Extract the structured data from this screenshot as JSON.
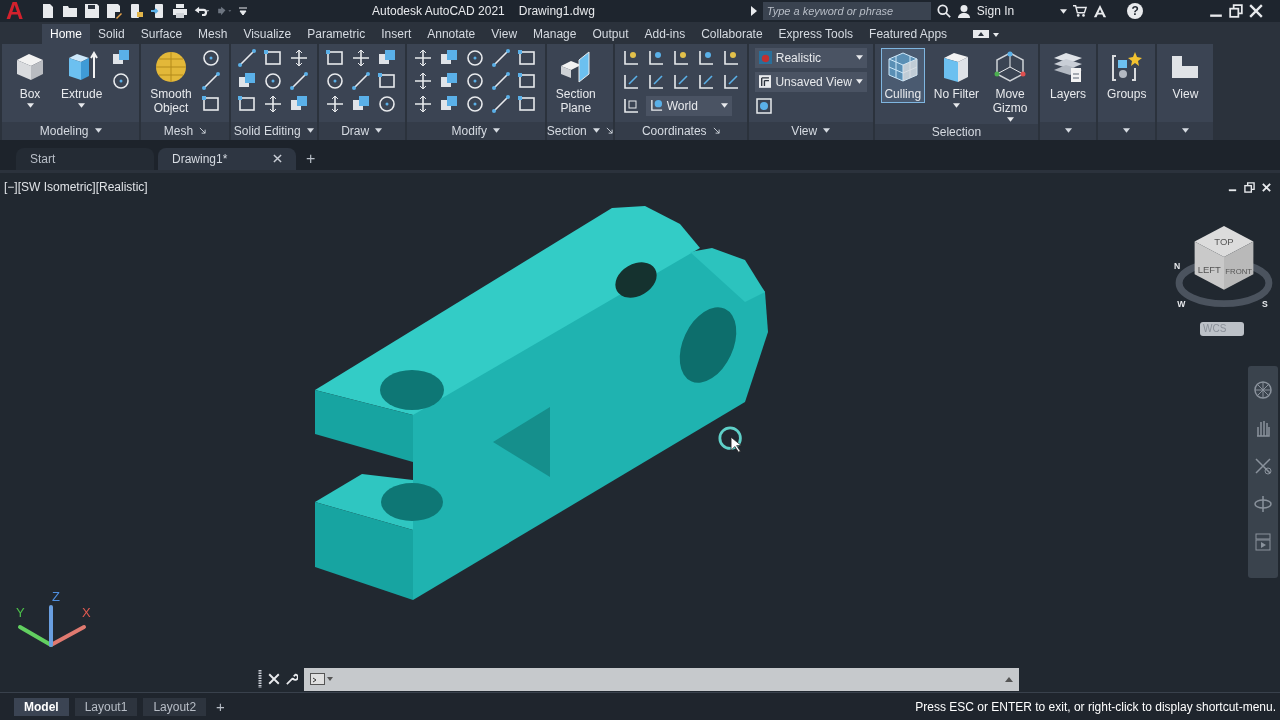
{
  "titlebar": {
    "logo": "A",
    "title": "Autodesk AutoCAD 2021",
    "file": "Drawing1.dwg",
    "search_placeholder": "Type a keyword or phrase",
    "sign_in": "Sign In",
    "help": "?"
  },
  "ribbon_tabs": [
    {
      "label": "Home",
      "selected": true
    },
    {
      "label": "Solid",
      "selected": false
    },
    {
      "label": "Surface",
      "selected": false
    },
    {
      "label": "Mesh",
      "selected": false
    },
    {
      "label": "Visualize",
      "selected": false
    },
    {
      "label": "Parametric",
      "selected": false
    },
    {
      "label": "Insert",
      "selected": false
    },
    {
      "label": "Annotate",
      "selected": false
    },
    {
      "label": "View",
      "selected": false
    },
    {
      "label": "Manage",
      "selected": false
    },
    {
      "label": "Output",
      "selected": false
    },
    {
      "label": "Add-ins",
      "selected": false
    },
    {
      "label": "Collaborate",
      "selected": false
    },
    {
      "label": "Express Tools",
      "selected": false
    },
    {
      "label": "Featured Apps",
      "selected": false
    }
  ],
  "panels": [
    {
      "title": "Modeling",
      "dropdown": true,
      "launcher": false,
      "items": [
        {
          "kind": "large",
          "lines": [
            "Box"
          ],
          "dropdown": true,
          "selected": false
        },
        {
          "kind": "large",
          "lines": [
            "Extrude"
          ],
          "dropdown": true,
          "selected": false
        },
        {
          "kind": "grid"
        }
      ]
    },
    {
      "title": "Mesh",
      "dropdown": false,
      "launcher": true,
      "items": [
        {
          "kind": "large",
          "lines": [
            "Smooth",
            "Object"
          ],
          "dropdown": false,
          "selected": false
        },
        {
          "kind": "grid"
        }
      ]
    },
    {
      "title": "Solid Editing",
      "dropdown": true,
      "launcher": false,
      "items": [
        {
          "kind": "grid"
        }
      ]
    },
    {
      "title": "Draw",
      "dropdown": true,
      "launcher": false,
      "items": [
        {
          "kind": "grid"
        }
      ]
    },
    {
      "title": "Modify",
      "dropdown": true,
      "launcher": false,
      "items": [
        {
          "kind": "grid"
        }
      ]
    },
    {
      "title": "Section",
      "dropdown": true,
      "launcher": true,
      "items": [
        {
          "kind": "large",
          "lines": [
            "Section",
            "Plane"
          ],
          "dropdown": false,
          "selected": false
        }
      ]
    },
    {
      "title": "Coordinates",
      "dropdown": false,
      "launcher": true,
      "items": [
        {
          "kind": "coords",
          "field": "World"
        }
      ]
    },
    {
      "title": "View",
      "dropdown": true,
      "launcher": false,
      "items": [
        {
          "kind": "combos",
          "fields": [
            "Realistic",
            "Unsaved View"
          ]
        }
      ]
    },
    {
      "title": "Selection",
      "dropdown": false,
      "launcher": false,
      "items": [
        {
          "kind": "large",
          "lines": [
            "Culling"
          ],
          "dropdown": false,
          "selected": true
        },
        {
          "kind": "large",
          "lines": [
            "No Filter"
          ],
          "dropdown": true,
          "selected": false
        },
        {
          "kind": "large",
          "lines": [
            "Move",
            "Gizmo"
          ],
          "dropdown": true,
          "selected": false
        }
      ]
    },
    {
      "dropdown": true,
      "launcher": false,
      "items": [
        {
          "kind": "large",
          "lines": [
            "Layers"
          ],
          "dropdown": false,
          "selected": false
        }
      ]
    },
    {
      "dropdown": true,
      "launcher": false,
      "items": [
        {
          "kind": "large",
          "lines": [
            "Groups"
          ],
          "dropdown": false,
          "selected": false
        }
      ]
    },
    {
      "dropdown": true,
      "launcher": false,
      "items": [
        {
          "kind": "large",
          "lines": [
            "View"
          ],
          "dropdown": false,
          "selected": false
        }
      ]
    }
  ],
  "doc_tabs": [
    {
      "label": "Start",
      "selected": false,
      "closable": false
    },
    {
      "label": "Drawing1*",
      "selected": true,
      "closable": true
    }
  ],
  "new_tab": "+",
  "viewport": {
    "label": "[−][SW Isometric][Realistic]",
    "cube_faces": [
      "TOP",
      "LEFT",
      "FRONT"
    ],
    "compass": [
      "N",
      "W",
      "S"
    ],
    "wcs": "WCS",
    "axes": [
      "X",
      "Y",
      "Z"
    ]
  },
  "layout_tabs": [
    {
      "label": "Model",
      "selected": true
    },
    {
      "label": "Layout1",
      "selected": false
    },
    {
      "label": "Layout2",
      "selected": false
    }
  ],
  "new_layout": "+",
  "status_message": "Press ESC or ENTER to exit, or right-click to display shortcut-menu."
}
